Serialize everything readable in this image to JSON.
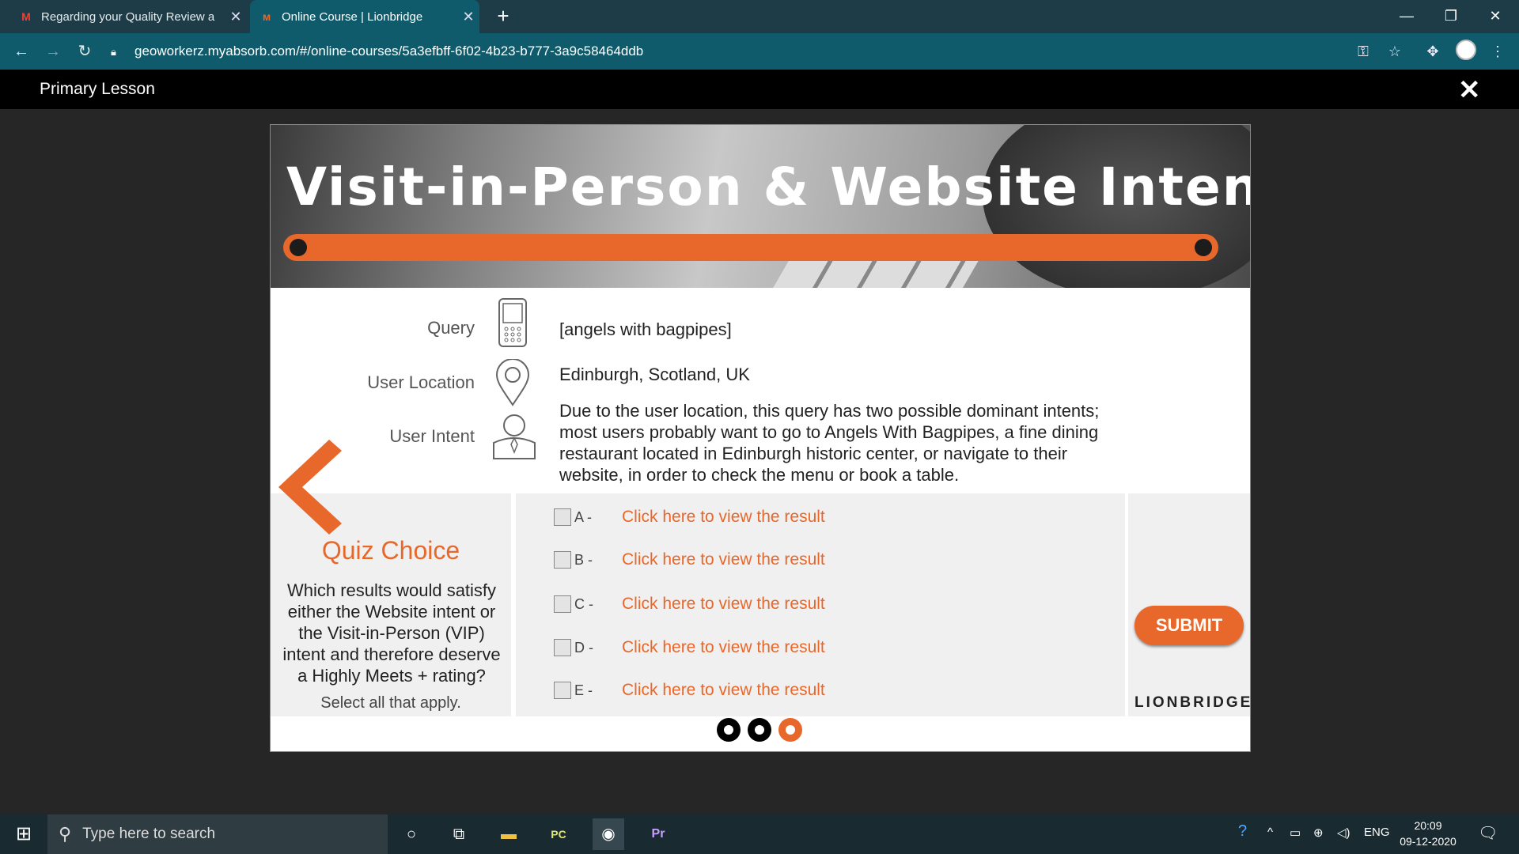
{
  "browser": {
    "tabs": [
      {
        "label": "Regarding your Quality Review a",
        "icon": "gmail-icon"
      },
      {
        "label": "Online Course | Lionbridge",
        "icon": "absorb-icon"
      }
    ],
    "url": "geoworkerz.myabsorb.com/#/online-courses/5a3efbff-6f02-4b23-b777-3a9c58464ddb"
  },
  "lesson": {
    "title": "Primary Lesson"
  },
  "slide": {
    "banner_title": "Visit-in-Person & Website Intents",
    "query_label": "Query",
    "query_value": "[angels with bagpipes]",
    "location_label": "User Location",
    "location_value": "Edinburgh, Scotland, UK",
    "intent_label": "User Intent",
    "intent_value": "Due to the user location, this query has two possible dominant intents; most users probably want  to go to Angels With Bagpipes, a fine dining restaurant located in Edinburgh historic center, or navigate to their website, in order to check the menu or book a table.",
    "quiz_title": "Quiz Choice",
    "quiz_question": "Which results would satisfy either the Website intent or the Visit-in-Person (VIP) intent and therefore deserve a Highly Meets + rating?",
    "quiz_instruction": "Select all that apply.",
    "options": [
      {
        "letter": "A -",
        "link": "Click here to view the result"
      },
      {
        "letter": "B -",
        "link": "Click here to view the result"
      },
      {
        "letter": "C -",
        "link": "Click here to view the result"
      },
      {
        "letter": "D -",
        "link": "Click here to view the result"
      },
      {
        "letter": "E -",
        "link": "Click here to view the result"
      }
    ],
    "submit_label": "SUBMIT",
    "logo_text": "LIONBRIDGE",
    "pager_count": 3,
    "pager_active": 3
  },
  "taskbar": {
    "search_placeholder": "Type here to search",
    "lang": "ENG",
    "time": "20:09",
    "date": "09-12-2020"
  },
  "colors": {
    "accent": "#e8672a",
    "chrome": "#0f5b6b"
  }
}
